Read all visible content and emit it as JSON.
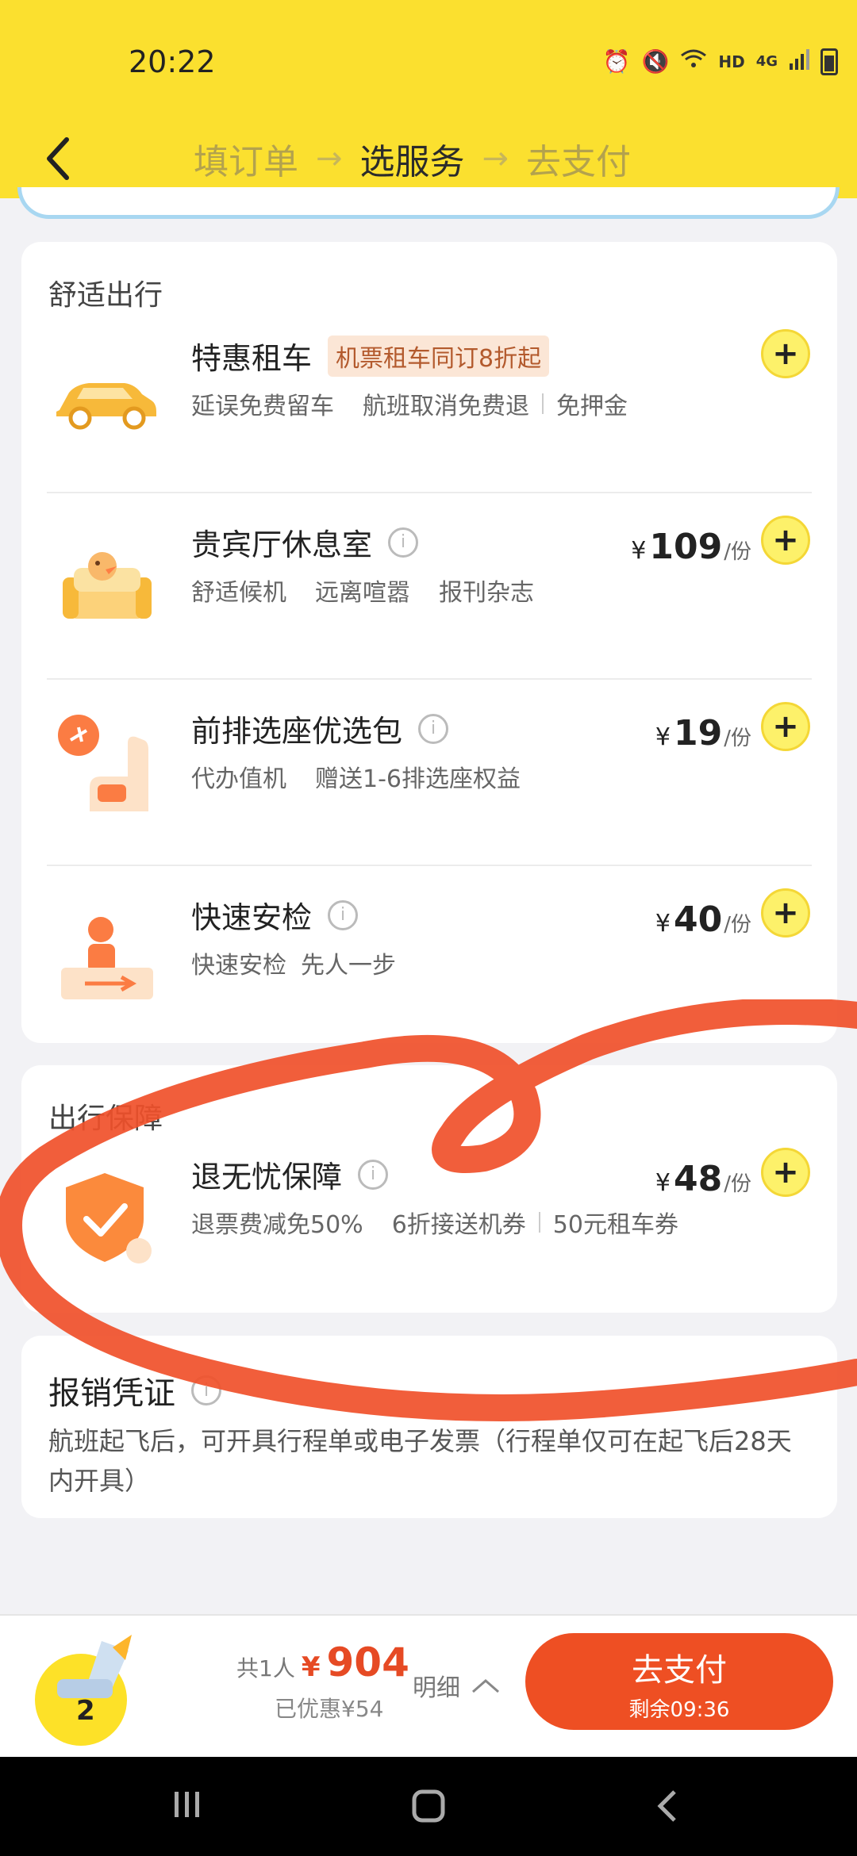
{
  "status_bar": {
    "time": "20:22",
    "network": "HD",
    "signal": "4G"
  },
  "nav": {
    "steps": [
      {
        "label": "填订单",
        "active": false
      },
      {
        "label": "选服务",
        "active": true
      },
      {
        "label": "去支付",
        "active": false
      }
    ],
    "arrow": "→"
  },
  "section_comfort": {
    "title": "舒适出行",
    "items": [
      {
        "name": "特惠租车",
        "tag": "机票租车同订8折起",
        "subs": [
          "延误免费留车",
          "航班取消免费退",
          "免押金"
        ],
        "icon": "car-icon"
      },
      {
        "name": "贵宾厅休息室",
        "price": "109",
        "unit": "/份",
        "subs": [
          "舒适候机",
          "远离喧嚣",
          "报刊杂志"
        ],
        "icon": "lounge-icon"
      },
      {
        "name": "前排选座优选包",
        "price": "19",
        "unit": "/份",
        "subs": [
          "代办值机",
          "赠送1-6排选座权益"
        ],
        "icon": "seat-icon"
      },
      {
        "name": "快速安检",
        "price": "40",
        "unit": "/份",
        "subs": [
          "快速安检",
          "先人一步"
        ],
        "icon": "security-check-icon"
      }
    ]
  },
  "section_protection": {
    "title": "出行保障",
    "items": [
      {
        "name": "退无忧保障",
        "price": "48",
        "unit": "/份",
        "subs": [
          "退票费减免50%",
          "6折接送机券",
          "50元租车券"
        ],
        "icon": "shield-icon"
      }
    ]
  },
  "section_reimbursement": {
    "title": "报销凭证",
    "text": "航班起飞后，可开具行程单或电子发票（行程单仅可在起飞后28天内开具）"
  },
  "currency": "¥",
  "add_label": "+",
  "info_label": "i",
  "bottom_bar": {
    "seat_count": "2",
    "people": "共1人",
    "total": "904",
    "discount": "已优惠¥54",
    "detail": "明细",
    "pay_label": "去支付",
    "remaining": "剩余09:36"
  }
}
